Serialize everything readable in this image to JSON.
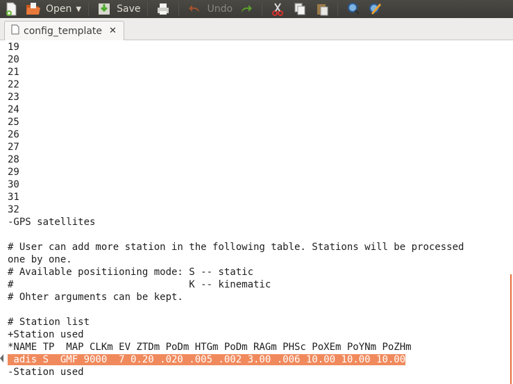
{
  "toolbar": {
    "new_icon": "new-document-icon",
    "open_label": "Open",
    "save_label": "Save",
    "undo_label": "Undo"
  },
  "tab": {
    "title": "config_template"
  },
  "editor": {
    "lines": [
      "19",
      "20",
      "21",
      "22",
      "23",
      "24",
      "25",
      "26",
      "27",
      "28",
      "29",
      "30",
      "31",
      "32",
      "-GPS satellites",
      "",
      "# User can add more station in the following table. Stations will be processed",
      "one by one.",
      "# Available positiioning mode: S -- static",
      "#                              K -- kinematic",
      "# Ohter arguments can be kept.",
      "",
      "# Station list",
      "+Station used",
      "*NAME TP  MAP CLKm EV ZTDm PoDm HTGm PoDm RAGm PHSc PoXEm PoYNm PoZHm",
      " adis S  GMF 9000  7 0.20 .020 .005 .002 3.00 .006 10.00 10.00 10.00",
      "-Station used"
    ],
    "highlighted_line_index": 25
  },
  "colors": {
    "selection": "#f08a5d",
    "toolbar": "#3c3b37"
  }
}
